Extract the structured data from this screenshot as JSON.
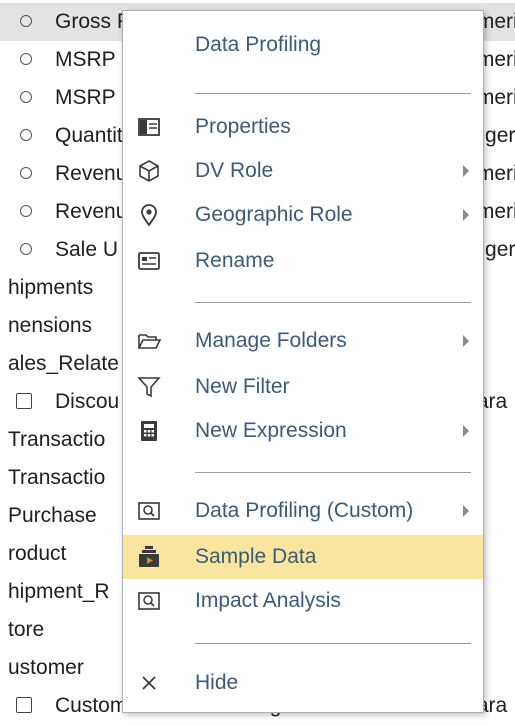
{
  "tree": {
    "rows": [
      {
        "label": "Gross Profit",
        "type": "Numeric",
        "marker": "radio"
      },
      {
        "label": "MSRP",
        "type": "Numeric",
        "marker": "radio"
      },
      {
        "label": "MSRP",
        "type": "Numeric",
        "marker": "radio"
      },
      {
        "label": "Quantity",
        "type": "Integer",
        "marker": "radio"
      },
      {
        "label": "Revenue",
        "type": "Numeric",
        "marker": "radio"
      },
      {
        "label": "Revenue",
        "type": "Numeric",
        "marker": "radio"
      },
      {
        "label": "Sale U",
        "type": "Integer",
        "marker": "radio"
      },
      {
        "label": "hipments",
        "type": "",
        "marker": "none"
      },
      {
        "label": "nensions",
        "type": "",
        "marker": "none"
      },
      {
        "label": "ales_Relate",
        "type": "",
        "marker": "none"
      },
      {
        "label": "Discou",
        "type": "Chara",
        "marker": "check"
      },
      {
        "label": "Transactio",
        "type": "",
        "marker": "none"
      },
      {
        "label": "Transactio",
        "type": "",
        "marker": "none"
      },
      {
        "label": "Purchase",
        "type": "",
        "marker": "none"
      },
      {
        "label": "roduct",
        "type": "",
        "marker": "none"
      },
      {
        "label": "hipment_R",
        "type": "",
        "marker": "none"
      },
      {
        "label": "tore",
        "type": "",
        "marker": "none"
      },
      {
        "label": "ustomer",
        "type": "",
        "marker": "none"
      },
      {
        "label": "Customer Business Region",
        "type": "Chara",
        "marker": "check"
      }
    ]
  },
  "menu": {
    "items": [
      {
        "label": "Data Profiling",
        "icon": "none",
        "submenu": false
      },
      {
        "label": "Properties",
        "icon": "properties-icon",
        "submenu": false
      },
      {
        "label": "DV Role",
        "icon": "cube-icon",
        "submenu": true
      },
      {
        "label": "Geographic Role",
        "icon": "map-pin-icon",
        "submenu": true
      },
      {
        "label": "Rename",
        "icon": "rename-icon",
        "submenu": false
      },
      {
        "label": "Manage Folders",
        "icon": "folder-open-icon",
        "submenu": true
      },
      {
        "label": "New Filter",
        "icon": "filter-icon",
        "submenu": false
      },
      {
        "label": "New Expression",
        "icon": "calculator-icon",
        "submenu": true
      },
      {
        "label": "Data Profiling (Custom)",
        "icon": "profile-search-icon",
        "submenu": true
      },
      {
        "label": "Sample Data",
        "icon": "sample-data-icon",
        "submenu": false,
        "highlighted": true
      },
      {
        "label": "Impact Analysis",
        "icon": "impact-search-icon",
        "submenu": false
      },
      {
        "label": "Hide",
        "icon": "close-icon",
        "submenu": false
      }
    ]
  },
  "colors": {
    "menu_text": "#3d5a78",
    "highlight": "#f8e6a0",
    "icon": "#3a3a3a",
    "sample_icon": "#d98a1a"
  }
}
